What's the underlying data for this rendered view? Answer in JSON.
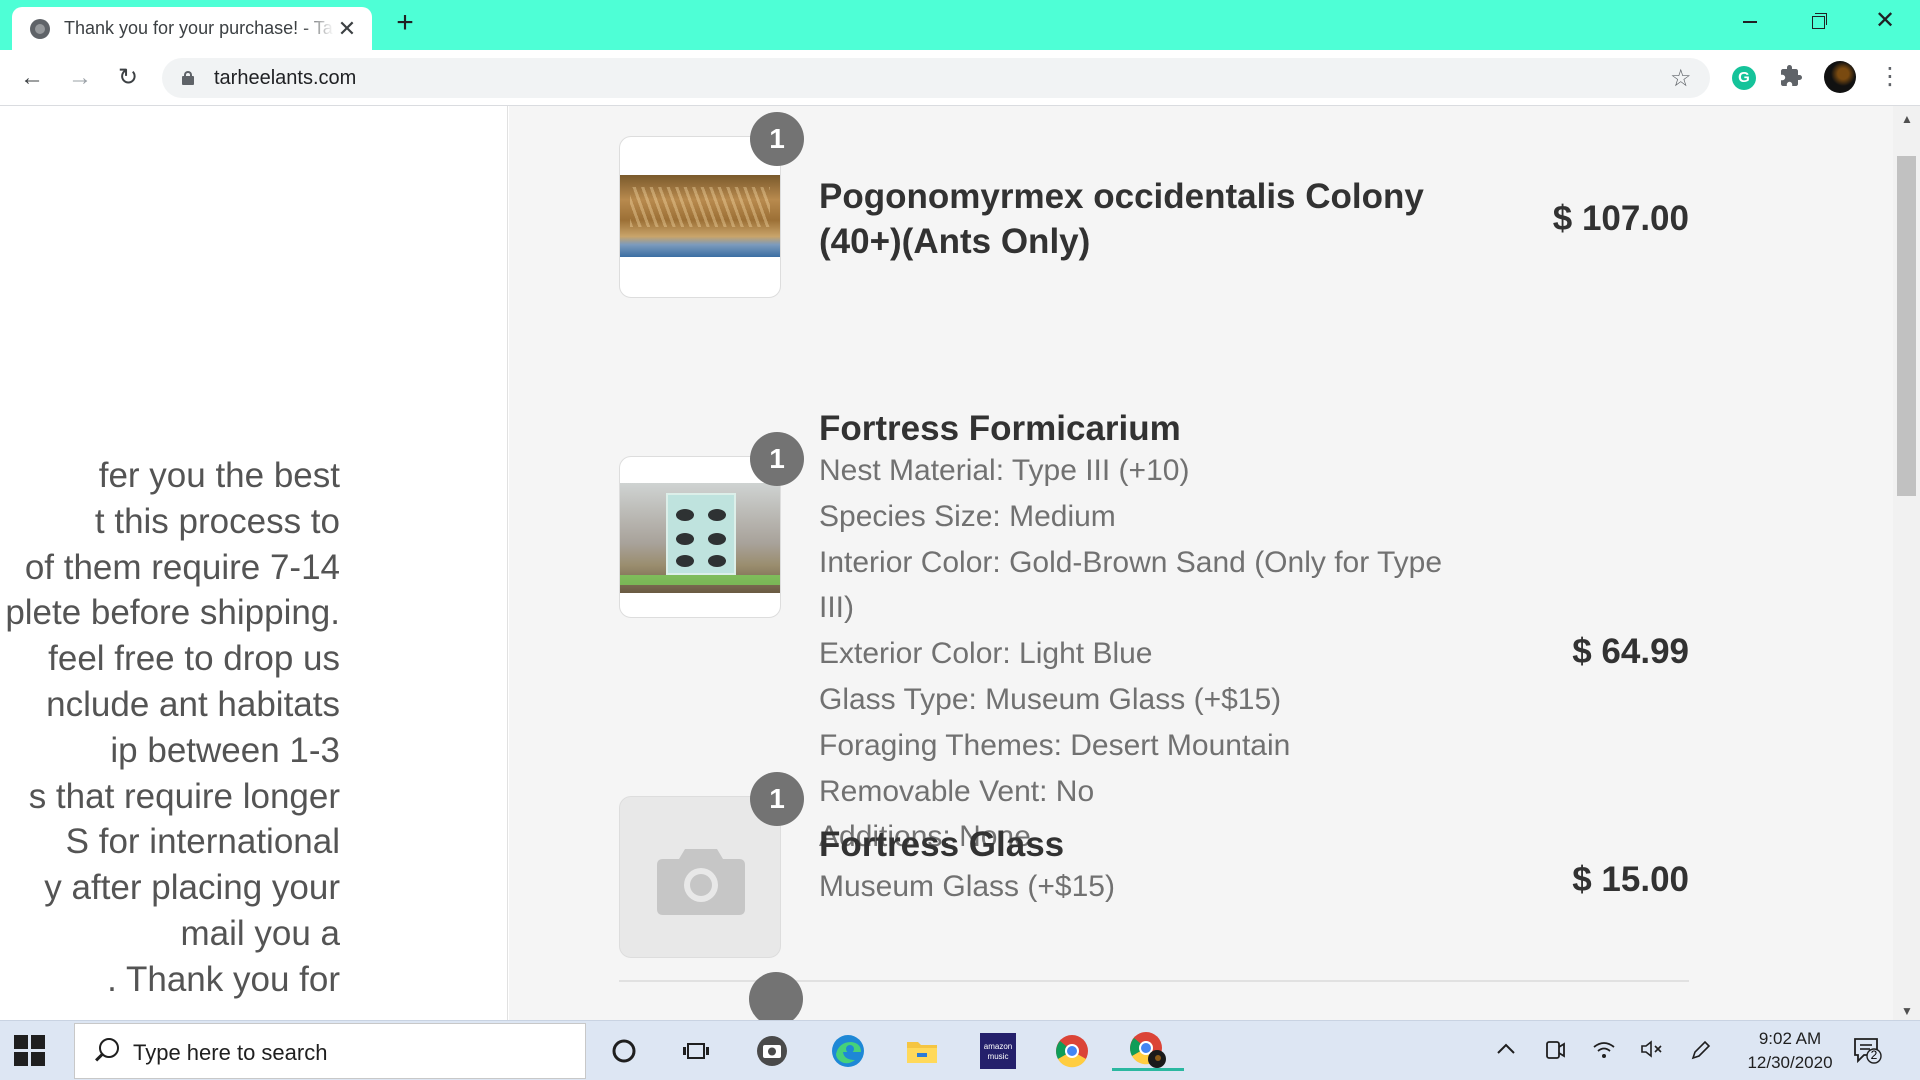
{
  "browser": {
    "tab_title": "Thank you for your purchase! - Tarheel Ants",
    "tab_close": "✕",
    "new_tab": "+",
    "url": "tarheelants.com",
    "controls": {
      "minimize": "",
      "maximize": "",
      "close": "✕"
    },
    "nav": {
      "back": "←",
      "forward": "→",
      "reload": "↻"
    },
    "star": "☆",
    "ext_grammarly": "G",
    "ext_puzzle": "✦",
    "menu": "⋮"
  },
  "left_panel": {
    "lines": [
      "fer you the best",
      "t this process to",
      "of them require 7-14",
      "plete before shipping.",
      "feel free to drop us",
      "nclude ant habitats",
      "ip between 1-3",
      "s that require longer",
      "S for international",
      "y after placing your",
      "mail you a",
      ". Thank you for"
    ]
  },
  "order_items": [
    {
      "quantity": "1",
      "name_lines": [
        "Pogonomyrmex occidentalis Colony",
        "(40+)(Ants Only)"
      ],
      "options": [],
      "price": "$ 107.00",
      "thumbnail": "ant-colony-photo"
    },
    {
      "quantity": "1",
      "name_lines": [
        "Fortress Formicarium"
      ],
      "options": [
        "Nest Material: Type III (+10)",
        "Species Size: Medium",
        "Interior Color: Gold-Brown Sand (Only for Type",
        "III)",
        "Exterior Color: Light Blue",
        "Glass Type: Museum Glass (+$15)",
        "Foraging Themes: Desert Mountain",
        "Removable Vent: No",
        "Additions: None"
      ],
      "price": "$ 64.99",
      "thumbnail": "formicarium-photo"
    },
    {
      "quantity": "1",
      "name_lines": [
        "Fortress Glass"
      ],
      "options": [
        "Museum Glass (+$15)"
      ],
      "price": "$ 15.00",
      "thumbnail": "camera-placeholder-icon"
    }
  ],
  "taskbar": {
    "search_placeholder": "Type here to search",
    "time": "9:02 AM",
    "date": "12/30/2020",
    "notification_count": "2",
    "amazon_music_label": "amazon music"
  },
  "colors": {
    "tabbar": "#4effd6",
    "badge": "#737373",
    "text_dark": "#323232",
    "text_muted": "#717171",
    "panel_bg": "#f5f5f5"
  }
}
